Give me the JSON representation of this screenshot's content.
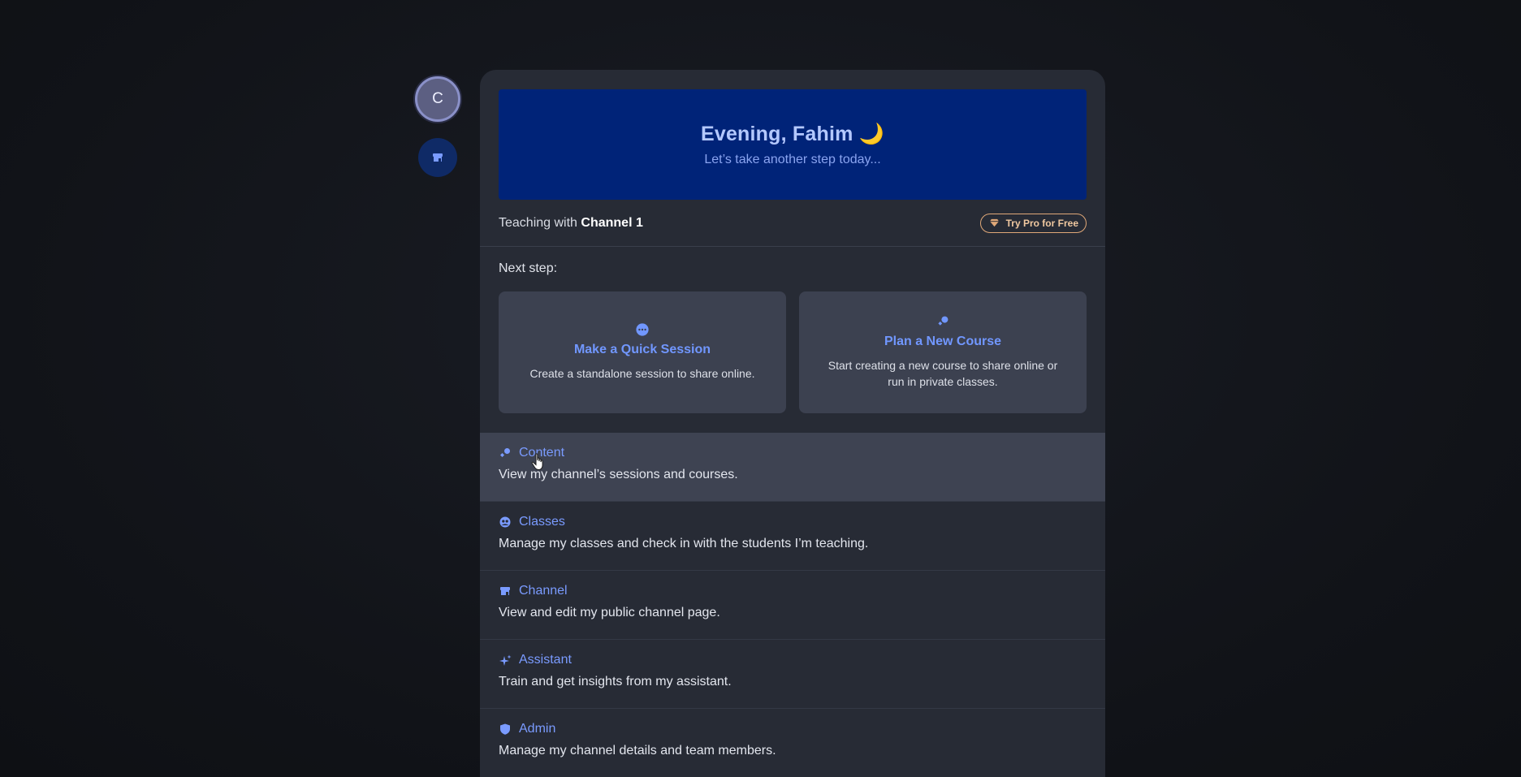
{
  "rail": {
    "avatar_letter": "C",
    "channel_icon": "storefront-icon"
  },
  "hero": {
    "title": "Evening, Fahim",
    "emoji": "🌙",
    "subtitle": "Let’s take another step today..."
  },
  "teaching": {
    "prefix": "Teaching with ",
    "channel_name": "Channel 1",
    "pro_button": "Try Pro for Free"
  },
  "next_step": {
    "label": "Next step:",
    "cards": [
      {
        "icon": "dots-circle-icon",
        "title": "Make a Quick Session",
        "desc": "Create a standalone session to share online."
      },
      {
        "icon": "shapes-icon",
        "title": "Plan a New Course",
        "desc": "Start creating a new course to share online or run in private classes."
      }
    ]
  },
  "menu": [
    {
      "icon": "shapes-icon",
      "title": "Content",
      "desc": "View my channel’s sessions and courses."
    },
    {
      "icon": "people-icon",
      "title": "Classes",
      "desc": "Manage my classes and check in with the students I’m teaching."
    },
    {
      "icon": "storefront-icon",
      "title": "Channel",
      "desc": "View and edit my public channel page."
    },
    {
      "icon": "sparkle-icon",
      "title": "Assistant",
      "desc": "Train and get insights from my assistant."
    },
    {
      "icon": "shield-icon",
      "title": "Admin",
      "desc": "Manage my channel details and team members."
    }
  ],
  "colors": {
    "accent": "#7a9bff",
    "hero_bg": "#002378",
    "panel_bg": "#272b35",
    "card_bg": "#3c4150",
    "pro_border": "#e0a878"
  }
}
